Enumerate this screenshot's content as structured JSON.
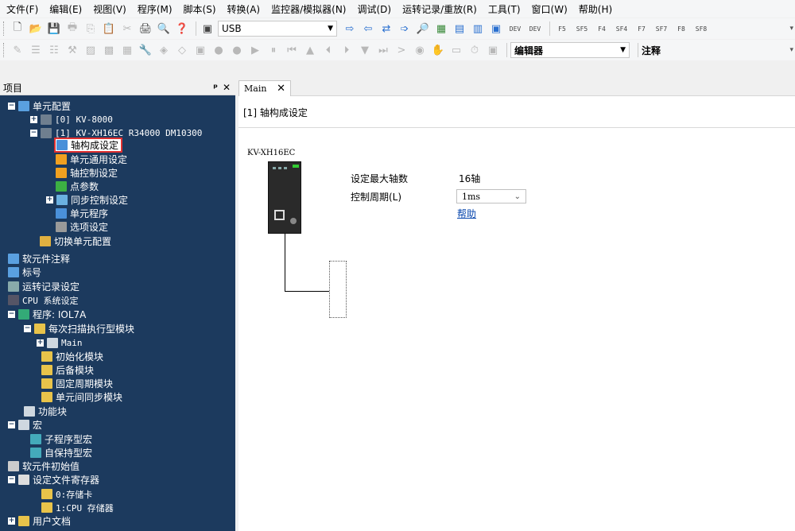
{
  "menu": [
    "文件(F)",
    "编辑(E)",
    "视图(V)",
    "程序(M)",
    "脚本(S)",
    "转换(A)",
    "监控器/模拟器(N)",
    "调试(D)",
    "运转记录/重放(R)",
    "工具(T)",
    "窗口(W)",
    "帮助(H)"
  ],
  "toolbar1": {
    "connection": "USB",
    "fkeys": [
      "F5",
      "SF5",
      "F4",
      "SF4",
      "F7",
      "SF7",
      "F8",
      "SF8"
    ]
  },
  "toolbar2": {
    "mode": "编辑器",
    "comment": "注释"
  },
  "panel": {
    "title": "项目",
    "pin": "ᵖ",
    "close": "✕"
  },
  "tree": [
    {
      "label": "单元配置",
      "exp": "−",
      "icon": "unit-config-icon",
      "color": "#5aa0e0"
    },
    {
      "label": "[0]  KV-8000",
      "exp": "+",
      "icon": "cpu-icon",
      "color": "#6f7f8f"
    },
    {
      "label": "[1]  KV-XH16EC   R34000  DM10300",
      "exp": "−",
      "icon": "cpu-icon",
      "color": "#6f7f8f"
    },
    {
      "label": "轴构成设定",
      "icon": "axis-config-icon",
      "color": "#4a90d9"
    },
    {
      "label": "单元通用设定",
      "icon": "gear-icon",
      "color": "#f0a020"
    },
    {
      "label": "轴控制设定",
      "icon": "gear-icon",
      "color": "#f0a020"
    },
    {
      "label": "点参数",
      "icon": "flag-icon",
      "color": "#3cb043"
    },
    {
      "label": "同步控制设定",
      "exp": "+",
      "icon": "sync-icon",
      "color": "#6ab0e0"
    },
    {
      "label": "单元程序",
      "icon": "program-icon",
      "color": "#4a90d9"
    },
    {
      "label": "选项设定",
      "icon": "gear-icon",
      "color": "#9a9a9a"
    },
    {
      "label": "切换单元配置",
      "icon": "switch-icon",
      "color": "#e0b040"
    },
    {
      "label": "软元件注释",
      "icon": "comment-icon",
      "color": "#5aa0e0"
    },
    {
      "label": "标号",
      "icon": "label-icon",
      "color": "#5aa0e0"
    },
    {
      "label": "运转记录设定",
      "icon": "record-icon",
      "color": "#8aa"
    },
    {
      "label": "CPU 系统设定",
      "icon": "cpu-settings-icon",
      "color": "#556"
    },
    {
      "label": "程序: IOL7A",
      "exp": "−",
      "icon": "program-icon",
      "color": "#3a7"
    },
    {
      "label": "每次扫描执行型模块",
      "exp": "−",
      "icon": "folder-icon",
      "color": "#e8c34a"
    },
    {
      "label": "Main",
      "exp": "+",
      "icon": "module-icon",
      "color": "#cfd8e0"
    },
    {
      "label": "初始化模块",
      "icon": "folder-icon",
      "color": "#e8c34a"
    },
    {
      "label": "后备模块",
      "icon": "folder-icon",
      "color": "#e8c34a"
    },
    {
      "label": "固定周期模块",
      "icon": "folder-icon",
      "color": "#e8c34a"
    },
    {
      "label": "单元间同步模块",
      "icon": "folder-icon",
      "color": "#e8c34a"
    },
    {
      "label": "功能块",
      "icon": "function-block-icon",
      "color": "#cfd8e0"
    },
    {
      "label": "宏",
      "exp": "−",
      "icon": "macro-icon",
      "color": "#cfd8e0"
    },
    {
      "label": "子程序型宏",
      "icon": "subroutine-icon",
      "color": "#4ab"
    },
    {
      "label": "自保持型宏",
      "icon": "self-hold-icon",
      "color": "#4ab"
    },
    {
      "label": "软元件初始值",
      "icon": "init-value-icon",
      "color": "#ccc"
    },
    {
      "label": "设定文件寄存器",
      "exp": "−",
      "icon": "register-icon",
      "color": "#ddd"
    },
    {
      "label": "0:存储卡",
      "icon": "folder-icon",
      "color": "#e8c34a"
    },
    {
      "label": "1:CPU 存储器",
      "icon": "folder-icon",
      "color": "#e8c34a"
    },
    {
      "label": "用户文档",
      "exp": "+",
      "icon": "document-icon",
      "color": "#e8c34a"
    }
  ],
  "tab": {
    "label": "Main",
    "close": "✕"
  },
  "editor": {
    "title": "[1] 轴构成设定",
    "module_name": "KV-XH16EC",
    "max_axes_label": "设定最大轴数",
    "max_axes_value": "16轴",
    "cycle_label": "控制周期(L)",
    "cycle_value": "1ms",
    "help_link": "帮助"
  }
}
